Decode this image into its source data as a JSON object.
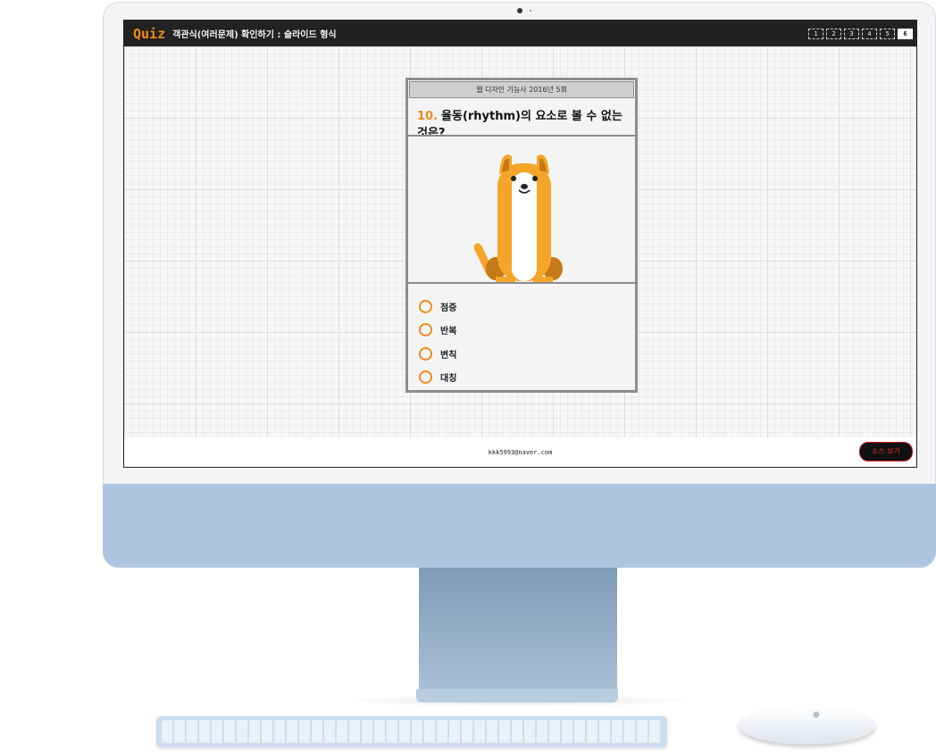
{
  "topbar": {
    "logo": "Quiz",
    "title": "객관식(여러문제) 확인하기 : 슬라이드 형식",
    "pages": [
      "1",
      "2",
      "3",
      "4",
      "5",
      "6"
    ],
    "active_page": "6"
  },
  "quiz": {
    "source": "웹 디자인 기능사 2016년 5회",
    "number": "10.",
    "question": "율동(rhythm)의 요소로 볼 수 없는 것은?",
    "options": [
      "점증",
      "반복",
      "변칙",
      "대칭"
    ]
  },
  "footer": {
    "email": "kkk5993@naver.com",
    "source_button": "소스 보기"
  },
  "colors": {
    "accent": "#f08a1c",
    "topbar_bg": "#222222",
    "chin": "#aec5df",
    "source_button_text": "#e32b2b"
  },
  "icons": {
    "illustration": "dog-illustration",
    "option_marker": "radio-circle-icon",
    "brand": "apple-logo-icon"
  }
}
